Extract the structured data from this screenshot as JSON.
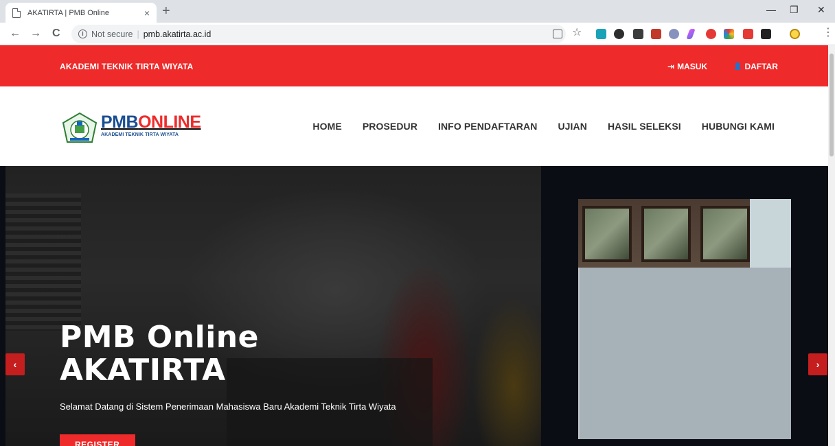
{
  "browser": {
    "tab_title": "AKATIRTA | PMB Online",
    "tab_close": "×",
    "new_tab": "+",
    "window_min": "—",
    "window_restore": "❐",
    "window_close": "✕",
    "back": "←",
    "forward": "→",
    "reload": "C",
    "info": "i",
    "security_label": "Not secure",
    "separator": "|",
    "url": "pmb.akatirta.ac.id",
    "translate_icon": "translate-icon",
    "star": "☆",
    "menu": "⋮"
  },
  "topbar": {
    "brand": "AKADEMI TEKNIK TIRTA WIYATA",
    "login_icon": "⇥",
    "login": "MASUK",
    "register_icon": "👤",
    "register": "DAFTAR",
    "color": "#ee2a2a"
  },
  "logo": {
    "pmb": "PMB",
    "online": "ONLINE",
    "subtitle": "AKADEMI TEKNIK TIRTA WIYATA"
  },
  "menu": [
    "HOME",
    "PROSEDUR",
    "INFO PENDAFTARAN",
    "UJIAN",
    "HASIL SELEKSI",
    "HUBUNGI KAMI"
  ],
  "hero": {
    "title_line1": "PMB Online",
    "title_line2": "AKATIRTA",
    "subtitle": "Selamat Datang di Sistem Penerimaan Mahasiswa Baru Akademi Teknik Tirta Wiyata",
    "button": "REGISTER",
    "prev": "‹",
    "next": "›"
  }
}
